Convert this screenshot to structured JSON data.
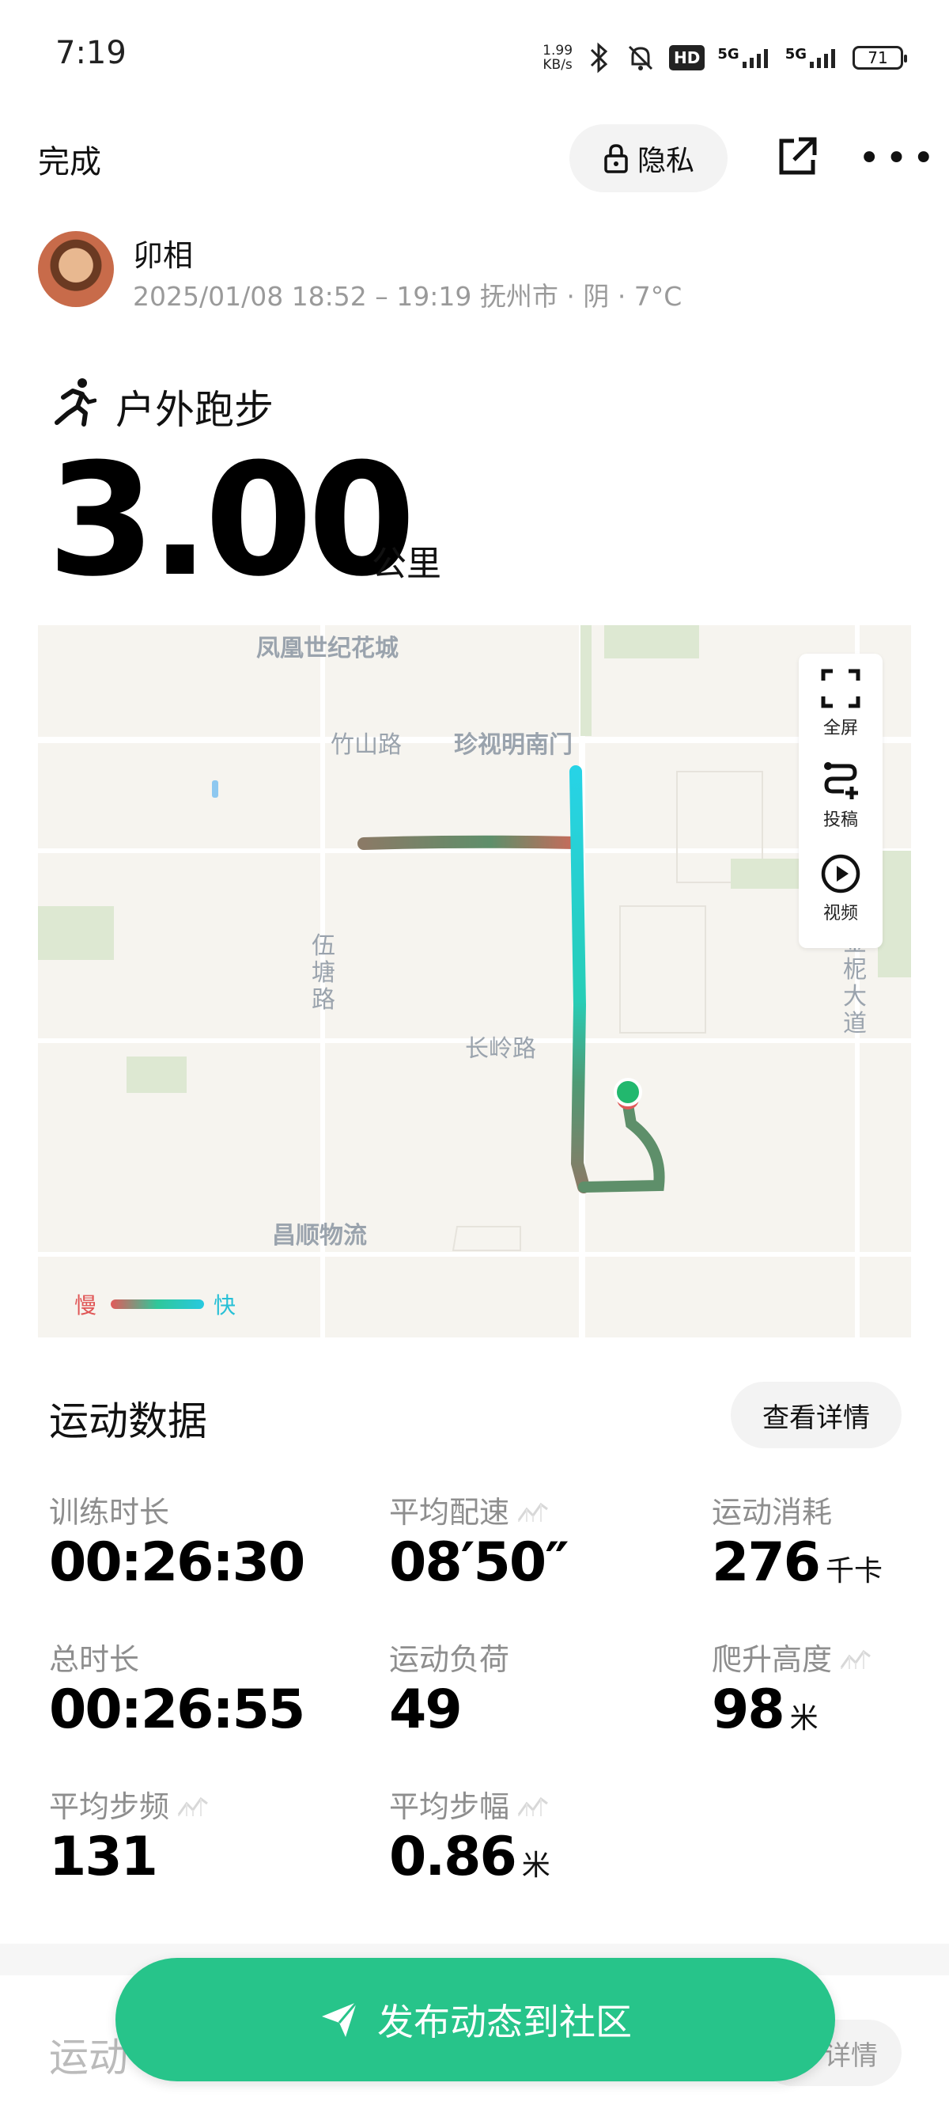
{
  "status_bar": {
    "time": "7:19",
    "net_speed_value": "1.99",
    "net_speed_unit": "KB/s",
    "hd_badge": "HD",
    "network_1": "5G",
    "network_2": "5G",
    "battery": "71"
  },
  "top_nav": {
    "done": "完成",
    "privacy": "隐私",
    "share_icon": "share-external-icon",
    "more_icon": "more-dots-icon"
  },
  "user": {
    "name": "卯相",
    "meta": "2025/01/08 18:52 – 19:19 抚州市 · 阴 · 7°C"
  },
  "workout": {
    "type": "户外跑步",
    "distance": "3.00",
    "distance_unit": "公里"
  },
  "map": {
    "labels": {
      "l1": "凤凰世纪花城",
      "l2": "竹山路",
      "l3": "珍视明南门",
      "l4": "伍",
      "l5": "塘",
      "l6": "路",
      "l7": "长岭路",
      "l8": "昌顺物流",
      "l9": "金",
      "l10": "柅",
      "l11": "大",
      "l12": "道"
    },
    "controls": {
      "fullscreen": "全屏",
      "submit": "投稿",
      "video": "视频"
    },
    "legend": {
      "slow": "慢",
      "fast": "快"
    }
  },
  "stats": {
    "title": "运动数据",
    "details": "查看详情",
    "items": [
      {
        "label": "训练时长",
        "value": "00:26:30",
        "unit": ""
      },
      {
        "label": "平均配速",
        "value": "08′50″",
        "unit": ""
      },
      {
        "label": "运动消耗",
        "value": "276",
        "unit": "千卡"
      },
      {
        "label": "总时长",
        "value": "00:26:55",
        "unit": ""
      },
      {
        "label": "运动负荷",
        "value": "49",
        "unit": ""
      },
      {
        "label": "爬升高度",
        "value": "98",
        "unit": "米"
      },
      {
        "label": "平均步频",
        "value": "131",
        "unit": ""
      },
      {
        "label": "平均步幅",
        "value": "0.86",
        "unit": "米"
      }
    ]
  },
  "section2": {
    "title": "运动",
    "btn": "详情"
  },
  "publish": {
    "label": "发布动态到社区"
  },
  "colors": {
    "accent_green": "#27c48a",
    "route_fast": "#27c9e0",
    "route_slow": "#e25a5a"
  }
}
